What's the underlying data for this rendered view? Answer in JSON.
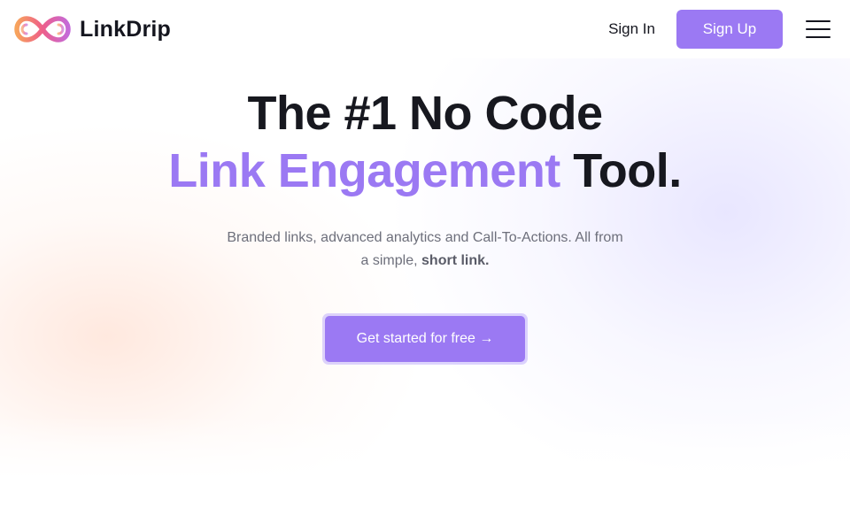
{
  "header": {
    "brand": "LinkDrip",
    "sign_in_label": "Sign In",
    "sign_up_label": "Sign Up"
  },
  "hero": {
    "headline_line1": "The #1 No Code",
    "headline_accent": "Link Engagement",
    "headline_end": "Tool.",
    "subtext_main": "Branded links, advanced analytics and Call-To-Actions. All from a simple,",
    "subtext_bold": "short link.",
    "cta_label": "Get started for free →"
  },
  "colors": {
    "accent": "#9b79f3",
    "logo_gradient_start": "#f7a35c",
    "logo_gradient_mid": "#ee5e8a",
    "logo_gradient_end": "#c46ad9",
    "text_dark": "#17181f",
    "text_muted": "#6d6f7b"
  },
  "icons": {
    "logo": "infinity-link-icon",
    "menu": "hamburger-menu-icon",
    "cta_arrow": "arrow-right-icon"
  }
}
